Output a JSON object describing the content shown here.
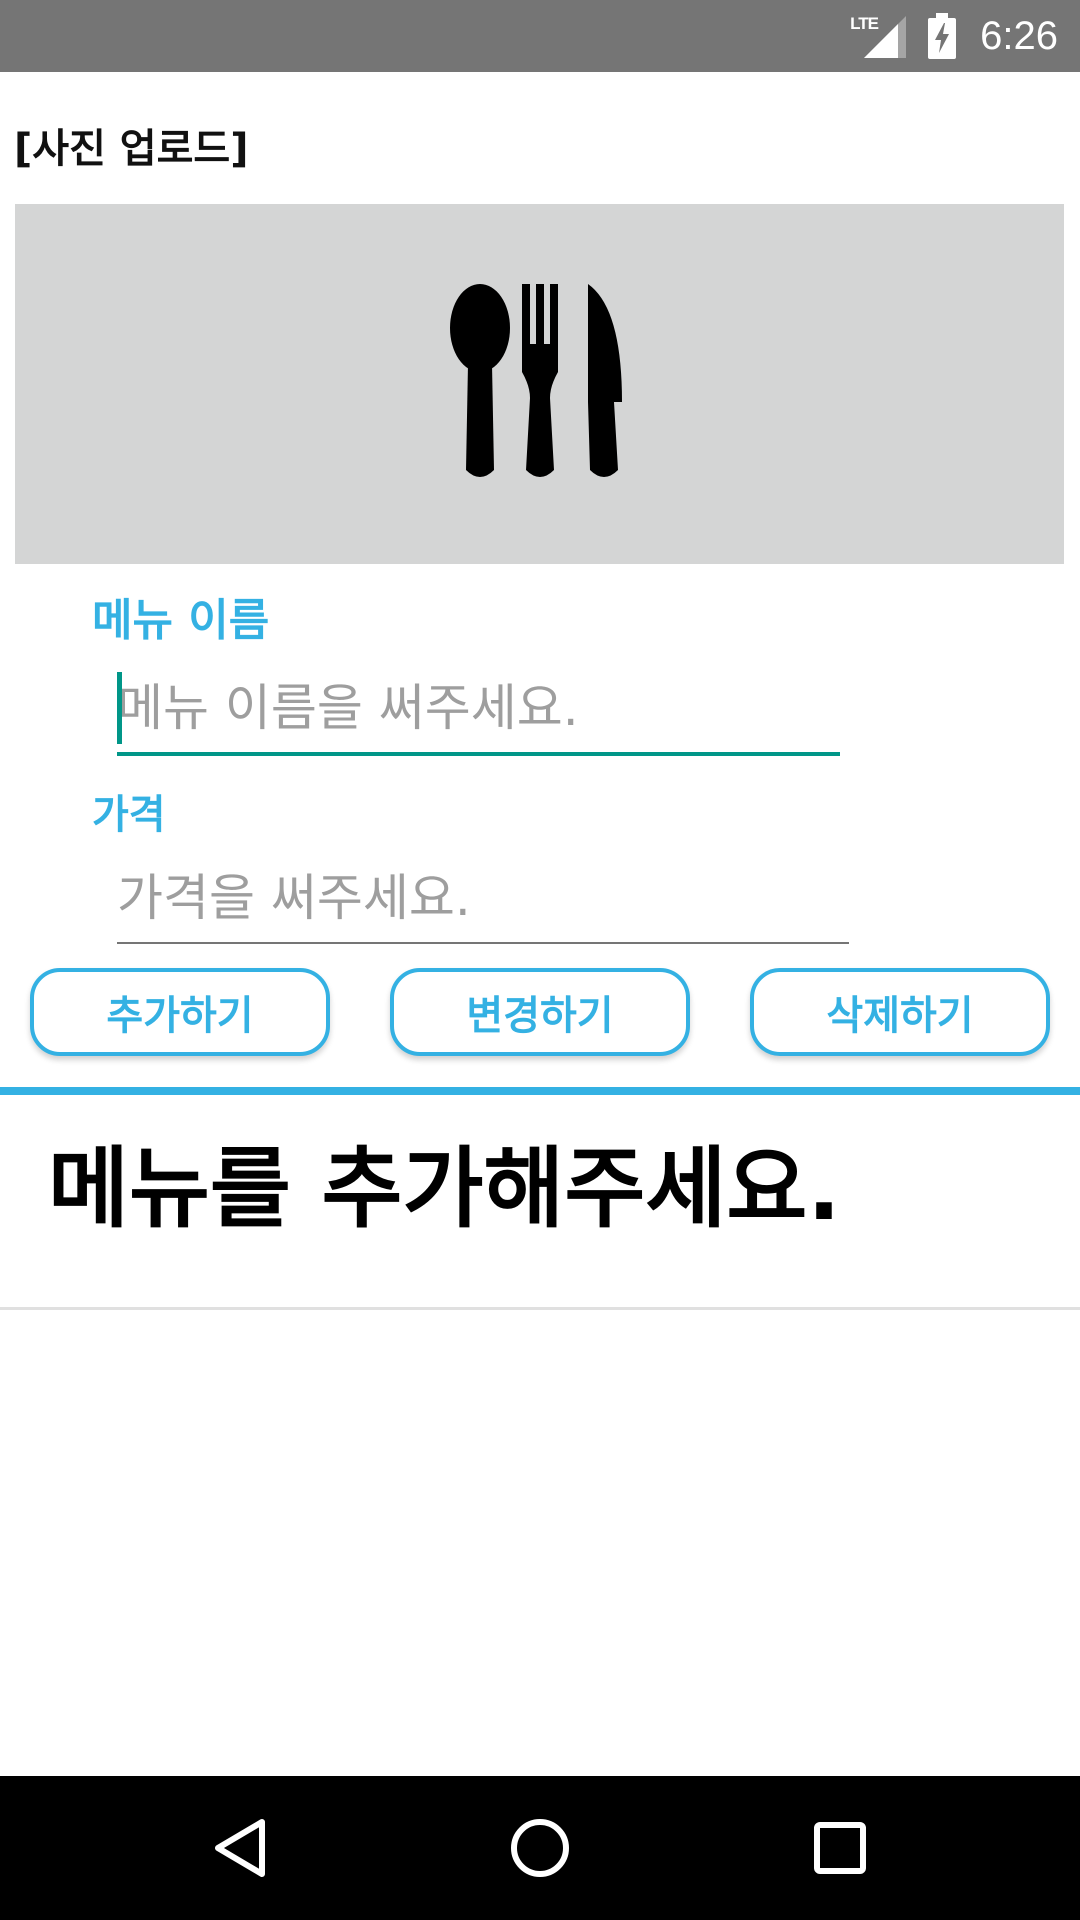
{
  "status_bar": {
    "network": "LTE",
    "time": "6:26"
  },
  "upload": {
    "heading": "[사진 업로드]",
    "placeholder_icon": "cutlery-icon",
    "background": "#d4d5d5"
  },
  "menu_name": {
    "label": "메뉴 이름",
    "value": "",
    "placeholder": "메뉴 이름을 써주세요."
  },
  "price": {
    "label": "가격",
    "value": "",
    "placeholder": "가격을 써주세요."
  },
  "buttons": {
    "add": "추가하기",
    "edit": "변경하기",
    "delete": "삭제하기"
  },
  "list": {
    "empty_message": "메뉴를 추가해주세요."
  },
  "colors": {
    "accent": "#34b1e3",
    "focus": "#009688",
    "status_bar": "#757575",
    "nav_bar": "#000000"
  },
  "nav_bar": {
    "back_icon": "back-triangle-icon",
    "home_icon": "home-circle-icon",
    "recents_icon": "recents-square-icon"
  }
}
